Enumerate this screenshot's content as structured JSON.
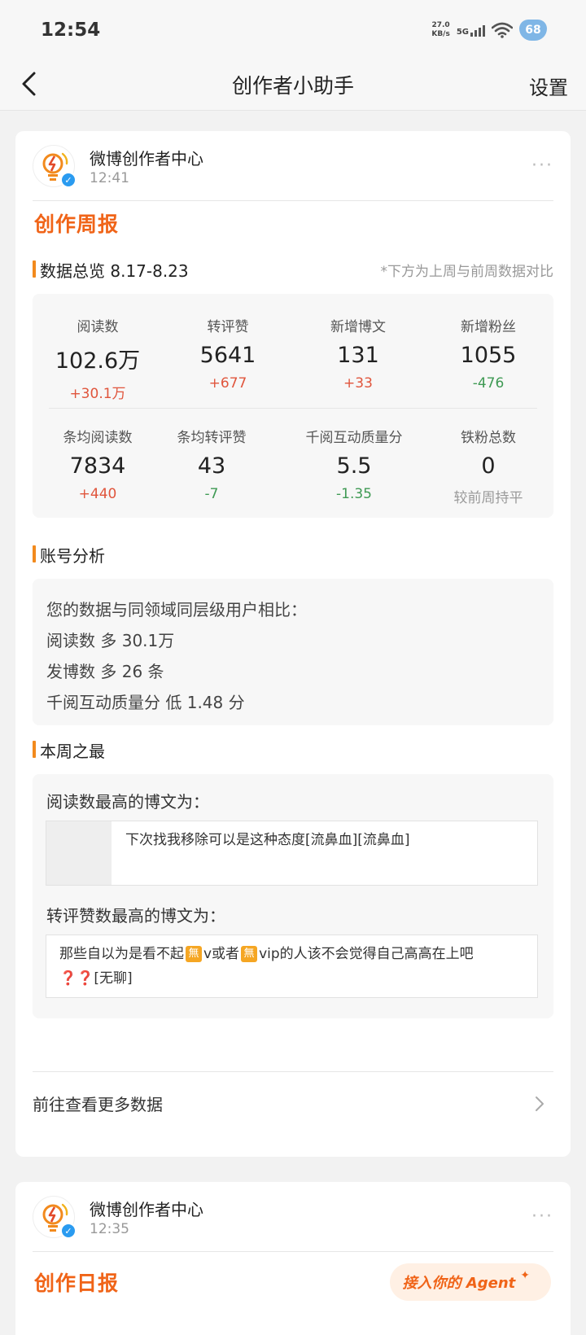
{
  "status_bar": {
    "time": "12:54",
    "net_speed_value": "27.0",
    "net_speed_unit": "KB/s",
    "network": "5G",
    "battery": "68"
  },
  "nav": {
    "title": "创作者小助手",
    "settings_label": "设置"
  },
  "weekly_card": {
    "account_name": "微博创作者中心",
    "time": "12:41",
    "report_title": "创作周报",
    "overview": {
      "title": "数据总览 8.17-8.23",
      "note": "*下方为上周与前周数据对比",
      "stats": [
        {
          "label": "阅读数",
          "value": "102.6万",
          "change": "+30.1万"
        },
        {
          "label": "转评赞",
          "value": "5641",
          "change": "+677"
        },
        {
          "label": "新增博文",
          "value": "131",
          "change": "+33"
        },
        {
          "label": "新增粉丝",
          "value": "1055",
          "change": "-476"
        },
        {
          "label": "条均阅读数",
          "value": "7834",
          "change": "+440"
        },
        {
          "label": "条均转评赞",
          "value": "43",
          "change": "-7"
        },
        {
          "label": "千阅互动质量分",
          "value": "5.5",
          "change": "-1.35"
        },
        {
          "label": "铁粉总数",
          "value": "0",
          "change": "较前周持平"
        }
      ]
    },
    "analysis": {
      "title": "账号分析",
      "lines": [
        "您的数据与同领域同层级用户相比：",
        "阅读数 多 30.1万",
        "发博数 多 26 条",
        "千阅互动质量分 低 1.48 分"
      ]
    },
    "best": {
      "title": "本周之最",
      "read_label": "阅读数最高的博文为：",
      "read_post": "下次找我移除可以是这种态度[流鼻血][流鼻血]",
      "engage_label": "转评赞数最高的博文为：",
      "engage_post_a": "那些自以为是看不起",
      "engage_post_emoji": "無",
      "engage_post_b": "v或者",
      "engage_post_c": "vip的人该不会觉得自己高高在上吧",
      "engage_post_marks": "❓❓",
      "engage_post_d": "[无聊]"
    },
    "more_data_label": "前往查看更多数据"
  },
  "daily_card": {
    "account_name": "微博创作者中心",
    "time": "12:35",
    "report_title": "创作日报",
    "agent_button": "接入你的 Agent"
  },
  "colors": {
    "accent": "#f06418",
    "increase": "#e0553c",
    "decrease": "#3f9a54",
    "verified": "#2a9bf0"
  }
}
